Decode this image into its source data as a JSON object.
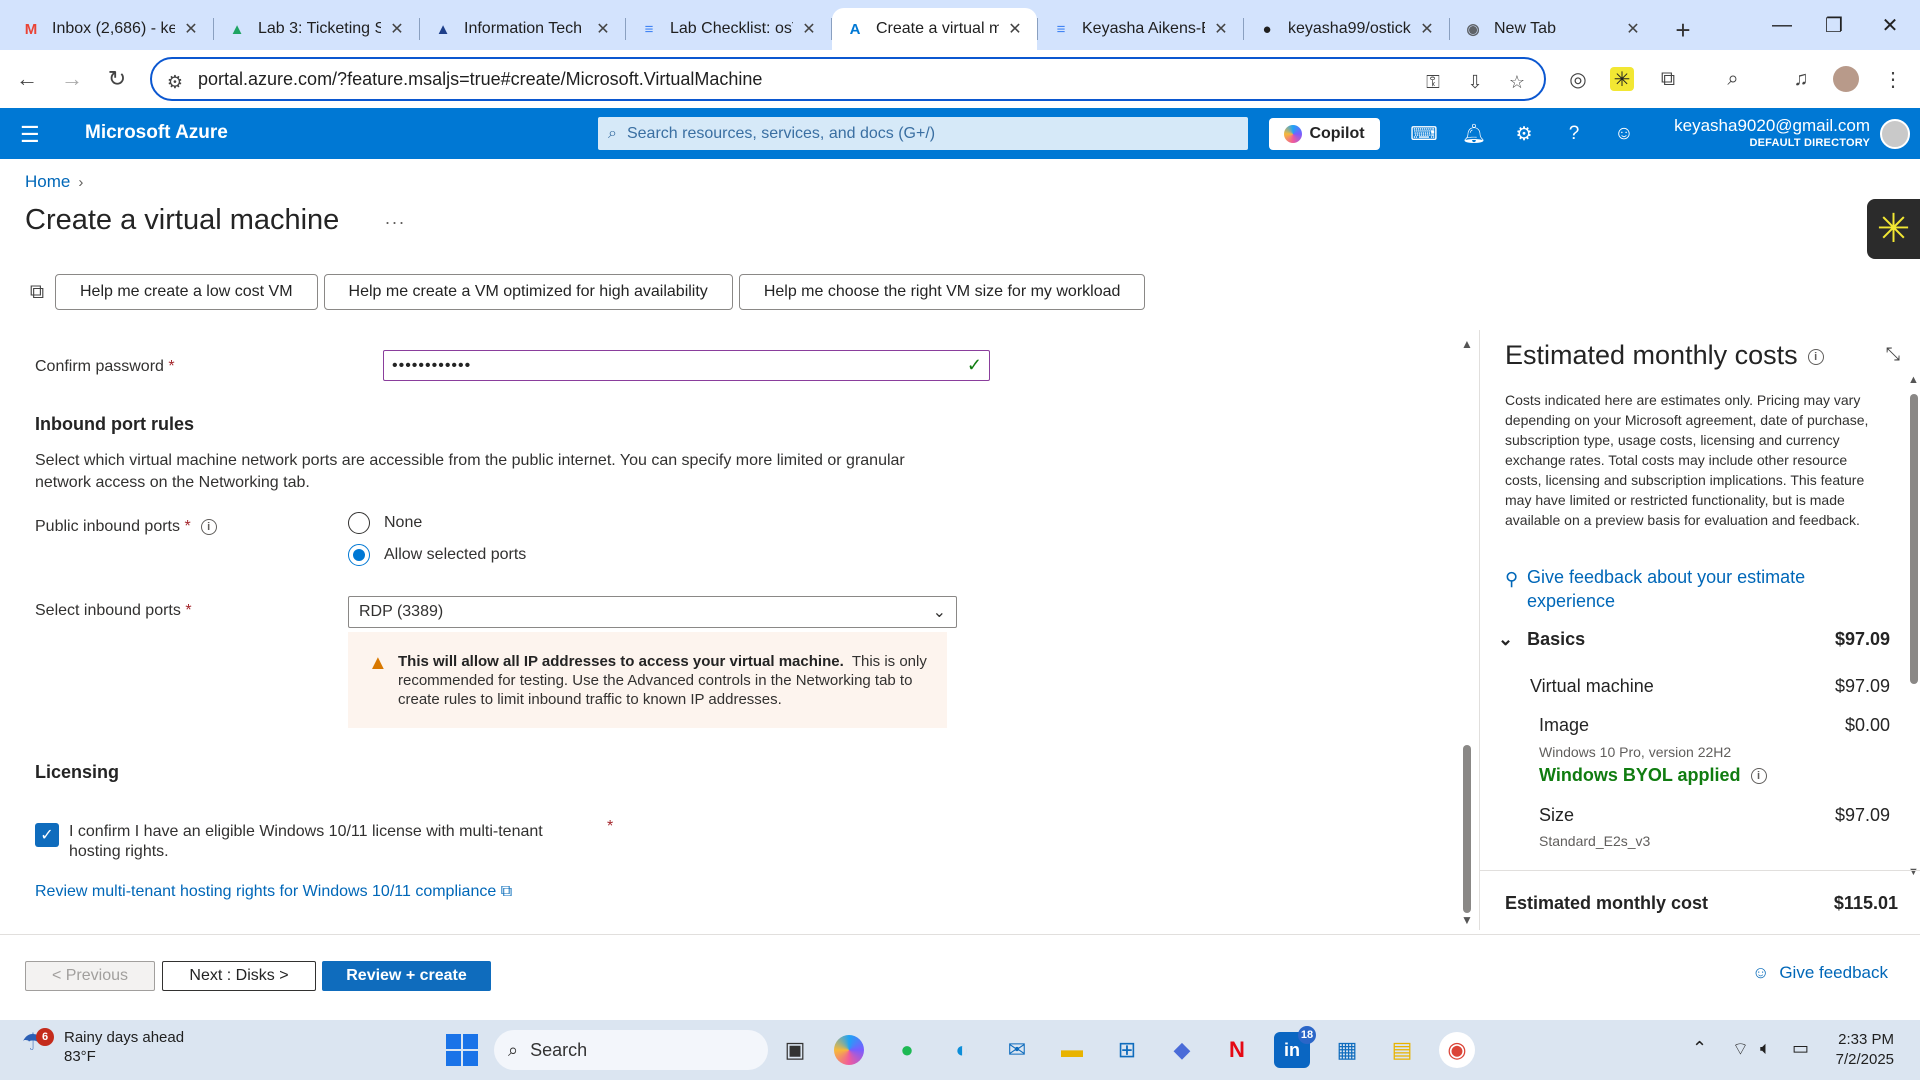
{
  "browser": {
    "tabs": [
      {
        "label": "Inbox (2,686) - ke",
        "icon": "gmail-icon",
        "glyph": "M",
        "color": "#ea4335",
        "active": false
      },
      {
        "label": "Lab 3: Ticketing S",
        "icon": "drive-icon",
        "glyph": "▲",
        "color": "#1fa463",
        "active": false
      },
      {
        "label": "Information Tech",
        "icon": "app-icon",
        "glyph": "▲",
        "color": "#1e3f8a",
        "active": false
      },
      {
        "label": "Lab Checklist: osT",
        "icon": "docs-icon",
        "glyph": "≡",
        "color": "#4285f4",
        "active": false
      },
      {
        "label": "Create a virtual m",
        "icon": "azure-icon",
        "glyph": "A",
        "color": "#0078d4",
        "active": true
      },
      {
        "label": "Keyasha Aikens-E",
        "icon": "docs-icon",
        "glyph": "≡",
        "color": "#4285f4",
        "active": false
      },
      {
        "label": "keyasha99/ostick",
        "icon": "github-icon",
        "glyph": "●",
        "color": "#1f1f1f",
        "active": false
      },
      {
        "label": "New Tab",
        "icon": "chrome-icon",
        "glyph": "◉",
        "color": "#5f6368",
        "active": false
      }
    ],
    "url": "portal.azure.com/?feature.msaljs=true#create/Microsoft.VirtualMachine"
  },
  "azure": {
    "brand": "Microsoft Azure",
    "search_placeholder": "Search resources, services, and docs (G+/)",
    "copilot_label": "Copilot",
    "account_email": "keyasha9020@gmail.com",
    "account_directory": "DEFAULT DIRECTORY"
  },
  "page": {
    "breadcrumb_home": "Home",
    "title": "Create a virtual machine",
    "more": "...",
    "help_buttons": [
      "Help me create a low cost VM",
      "Help me create a VM optimized for high availability",
      "Help me choose the right VM size for my workload"
    ]
  },
  "form": {
    "confirm_password_label": "Confirm password",
    "confirm_password_value": "••••••••••••",
    "inbound_heading": "Inbound port rules",
    "inbound_desc": "Select which virtual machine network ports are accessible from the public internet. You can specify more limited or granular network access on the Networking tab.",
    "public_ports_label": "Public inbound ports",
    "radio_none": "None",
    "radio_allow": "Allow selected ports",
    "radio_selected": "allow",
    "select_ports_label": "Select inbound ports",
    "select_ports_value": "RDP (3389)",
    "warning_bold": "This will allow all IP addresses to access your virtual machine.",
    "warning_text": "This is only recommended for testing.  Use the Advanced controls in the Networking tab to create rules to limit inbound traffic to known IP addresses.",
    "licensing_heading": "Licensing",
    "license_confirm": "I confirm I have an eligible Windows 10/11 license with multi-tenant hosting rights.",
    "license_checked": true,
    "review_link": "Review multi-tenant hosting rights for Windows 10/11 compliance"
  },
  "costs": {
    "title": "Estimated monthly costs",
    "note": "Costs indicated here are estimates only. Pricing may vary depending on your Microsoft agreement, date of purchase, subscription type, usage costs, licensing and currency exchange rates. Total costs may include other resource costs, licensing and subscription implications. This feature may have limited or restricted functionality, but is made available on a preview basis for evaluation and feedback.",
    "feedback_link": "Give feedback about your estimate experience",
    "basics_label": "Basics",
    "basics_value": "$97.09",
    "vm_label": "Virtual machine",
    "vm_value": "$97.09",
    "image_label": "Image",
    "image_value": "$0.00",
    "image_name": "Windows 10 Pro, version 22H2",
    "byol": "Windows BYOL applied",
    "size_label": "Size",
    "size_value": "$97.09",
    "size_name": "Standard_E2s_v3",
    "total_label": "Estimated monthly cost",
    "total_value": "$115.01"
  },
  "footer": {
    "previous": "< Previous",
    "next": "Next : Disks >",
    "review": "Review + create",
    "give_feedback": "Give feedback"
  },
  "taskbar": {
    "weather_badge": "6",
    "weather_title": "Rainy days ahead",
    "weather_temp": "83°F",
    "search": "Search",
    "linkedin_badge": "18",
    "time": "2:33 PM",
    "date": "7/2/2025"
  }
}
